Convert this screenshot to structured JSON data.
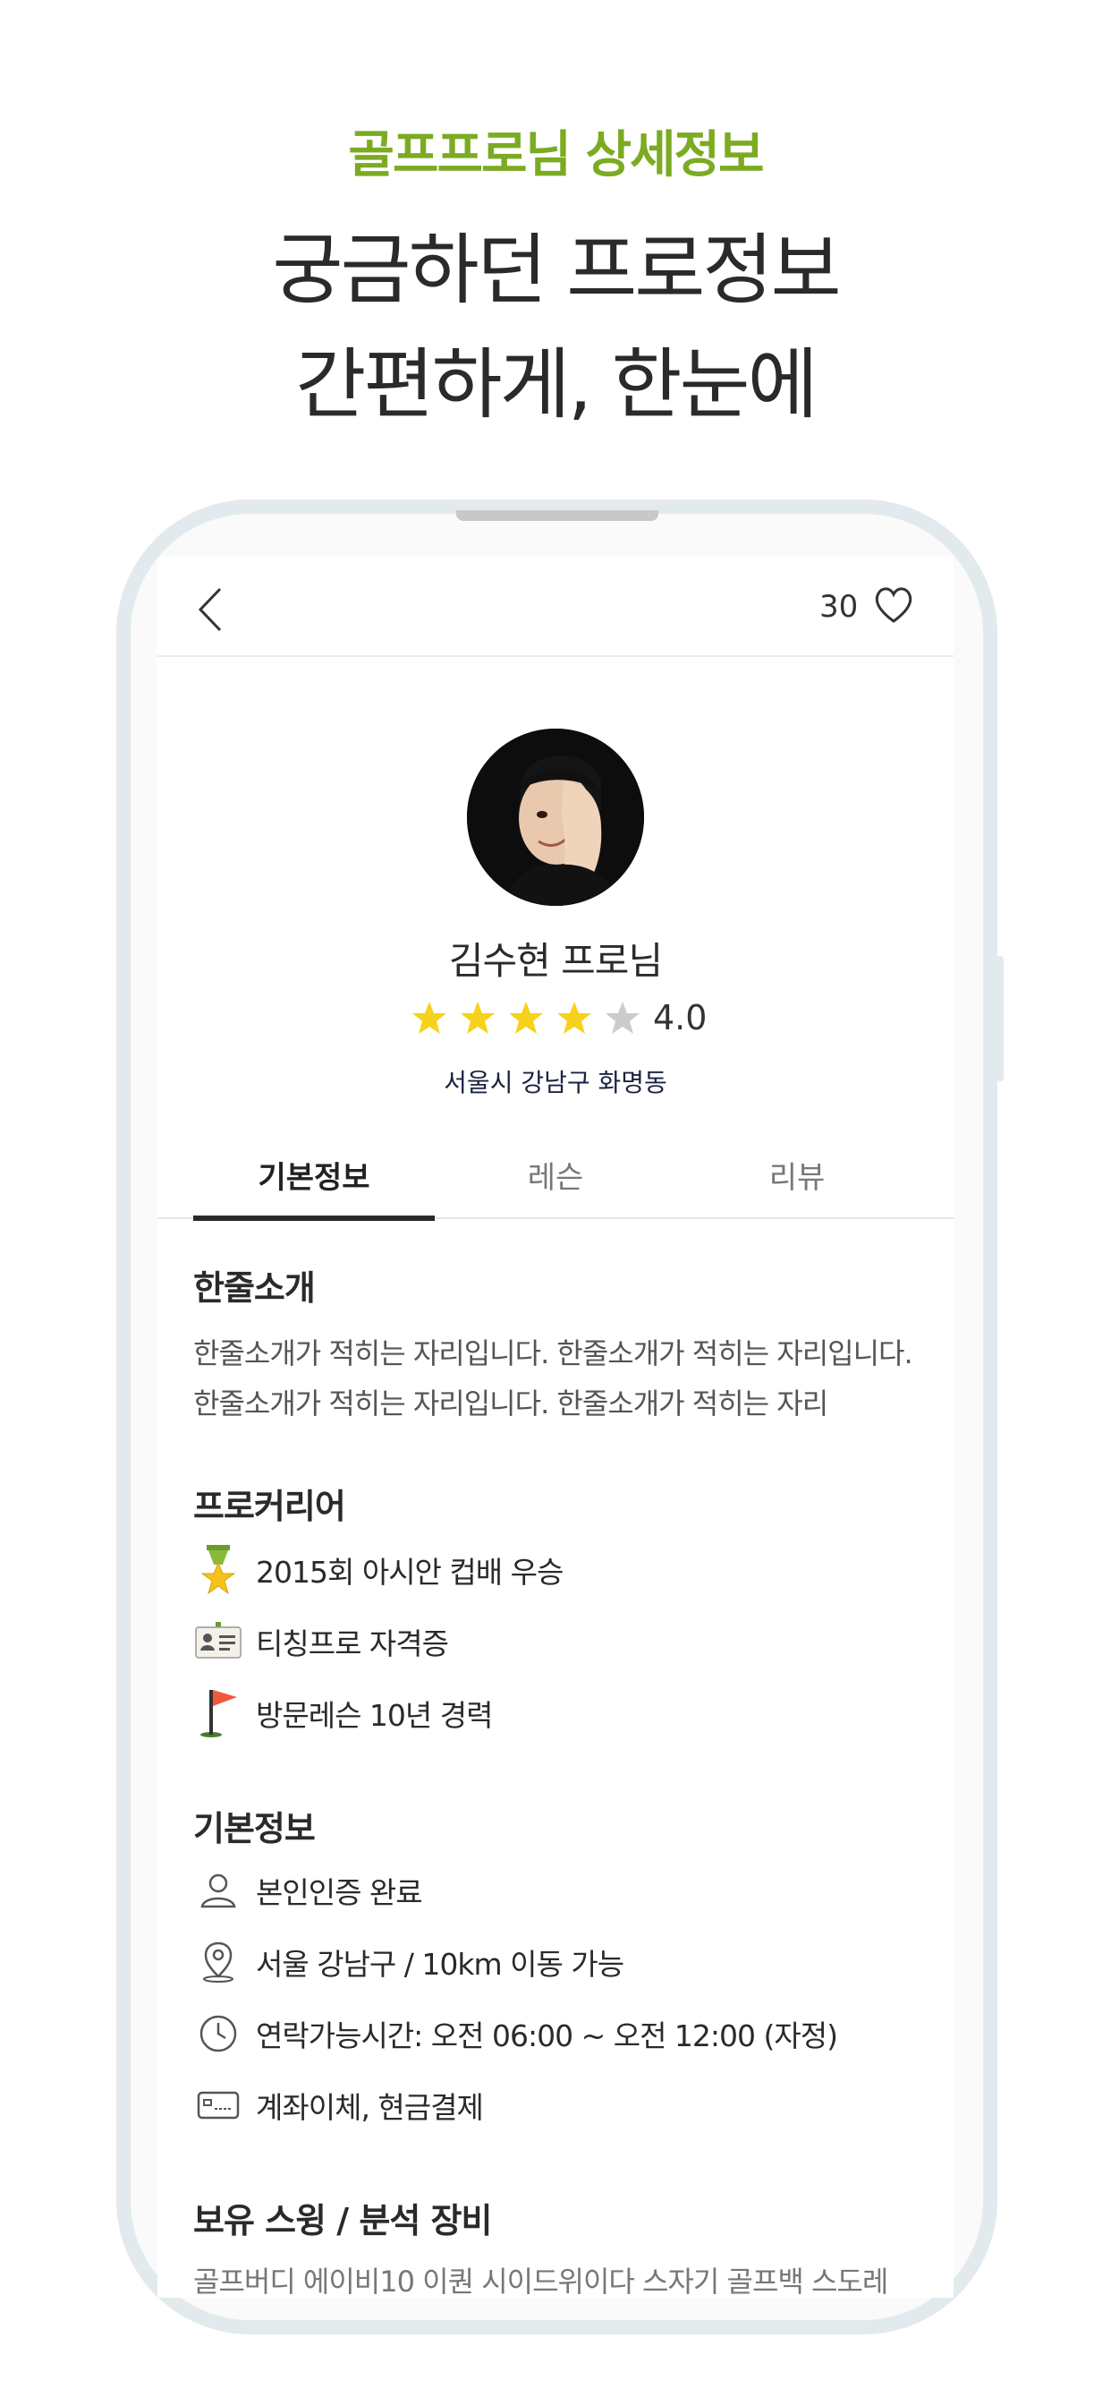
{
  "promo": {
    "subtitle": "골프프로님 상세정보",
    "title_line1": "궁금하던 프로정보",
    "title_line2": "간편하게, 한눈에"
  },
  "header": {
    "like_count": "30"
  },
  "profile": {
    "name": "김수현 프로님",
    "rating": "4.0",
    "rating_value": 4,
    "rating_max": 5,
    "location": "서울시 강남구 화명동"
  },
  "tabs": [
    {
      "label": "기본정보",
      "active": true
    },
    {
      "label": "레슨",
      "active": false
    },
    {
      "label": "리뷰",
      "active": false
    }
  ],
  "intro": {
    "title": "한줄소개",
    "text": "한줄소개가 적히는 자리입니다. 한줄소개가 적히는 자리입니다. 한줄소개가 적히는 자리입니다. 한줄소개가 적히는 자리"
  },
  "career": {
    "title": "프로커리어",
    "items": [
      {
        "icon": "medal-icon",
        "text": "2015회 아시안 컵배 우승"
      },
      {
        "icon": "id-card-icon",
        "text": "티칭프로 자격증"
      },
      {
        "icon": "golf-flag-icon",
        "text": "방문레슨 10년 경력"
      }
    ]
  },
  "basic_info": {
    "title": "기본정보",
    "items": [
      {
        "icon": "person-icon",
        "text": "본인인증 완료"
      },
      {
        "icon": "location-pin-icon",
        "text": "서울 강남구 / 10km 이동 가능"
      },
      {
        "icon": "clock-icon",
        "text": "연락가능시간: 오전 06:00 ~ 오전 12:00 (자정)"
      },
      {
        "icon": "card-icon",
        "text": "계좌이체, 현금결제"
      }
    ]
  },
  "equipment": {
    "title": "보유 스윙 / 분석 장비",
    "text": "골프버디 에이비10 이퀀 시이드위이다 스자기 골프백 스도레"
  },
  "colors": {
    "accent": "#7bab22",
    "star_filled": "#f7d21c",
    "star_empty": "#cccccc",
    "frame": "#e3eaed"
  }
}
